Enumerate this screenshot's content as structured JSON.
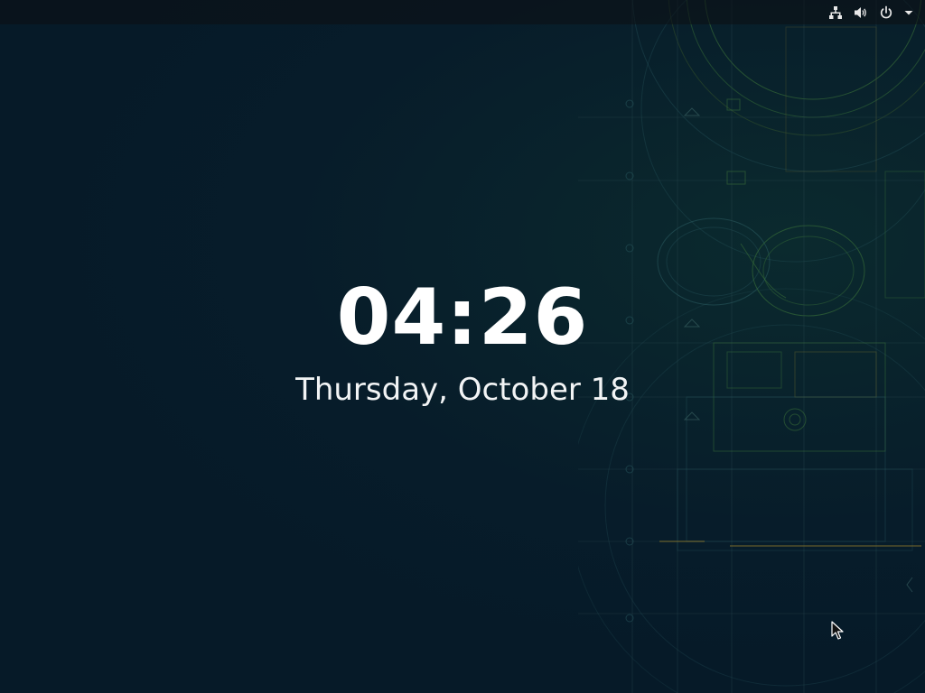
{
  "lock_screen": {
    "time": "04:26",
    "date": "Thursday, October 18"
  },
  "top_bar": {
    "status_icons": [
      "network-wired-icon",
      "volume-icon",
      "power-icon",
      "chevron-down-icon"
    ]
  },
  "colors": {
    "background": "#061a28",
    "top_bar": "#0c0f12",
    "clock_text": "#ffffff",
    "wallpaper_lines_green": "#3f7a3a",
    "wallpaper_lines_teal": "#2c5d63"
  }
}
